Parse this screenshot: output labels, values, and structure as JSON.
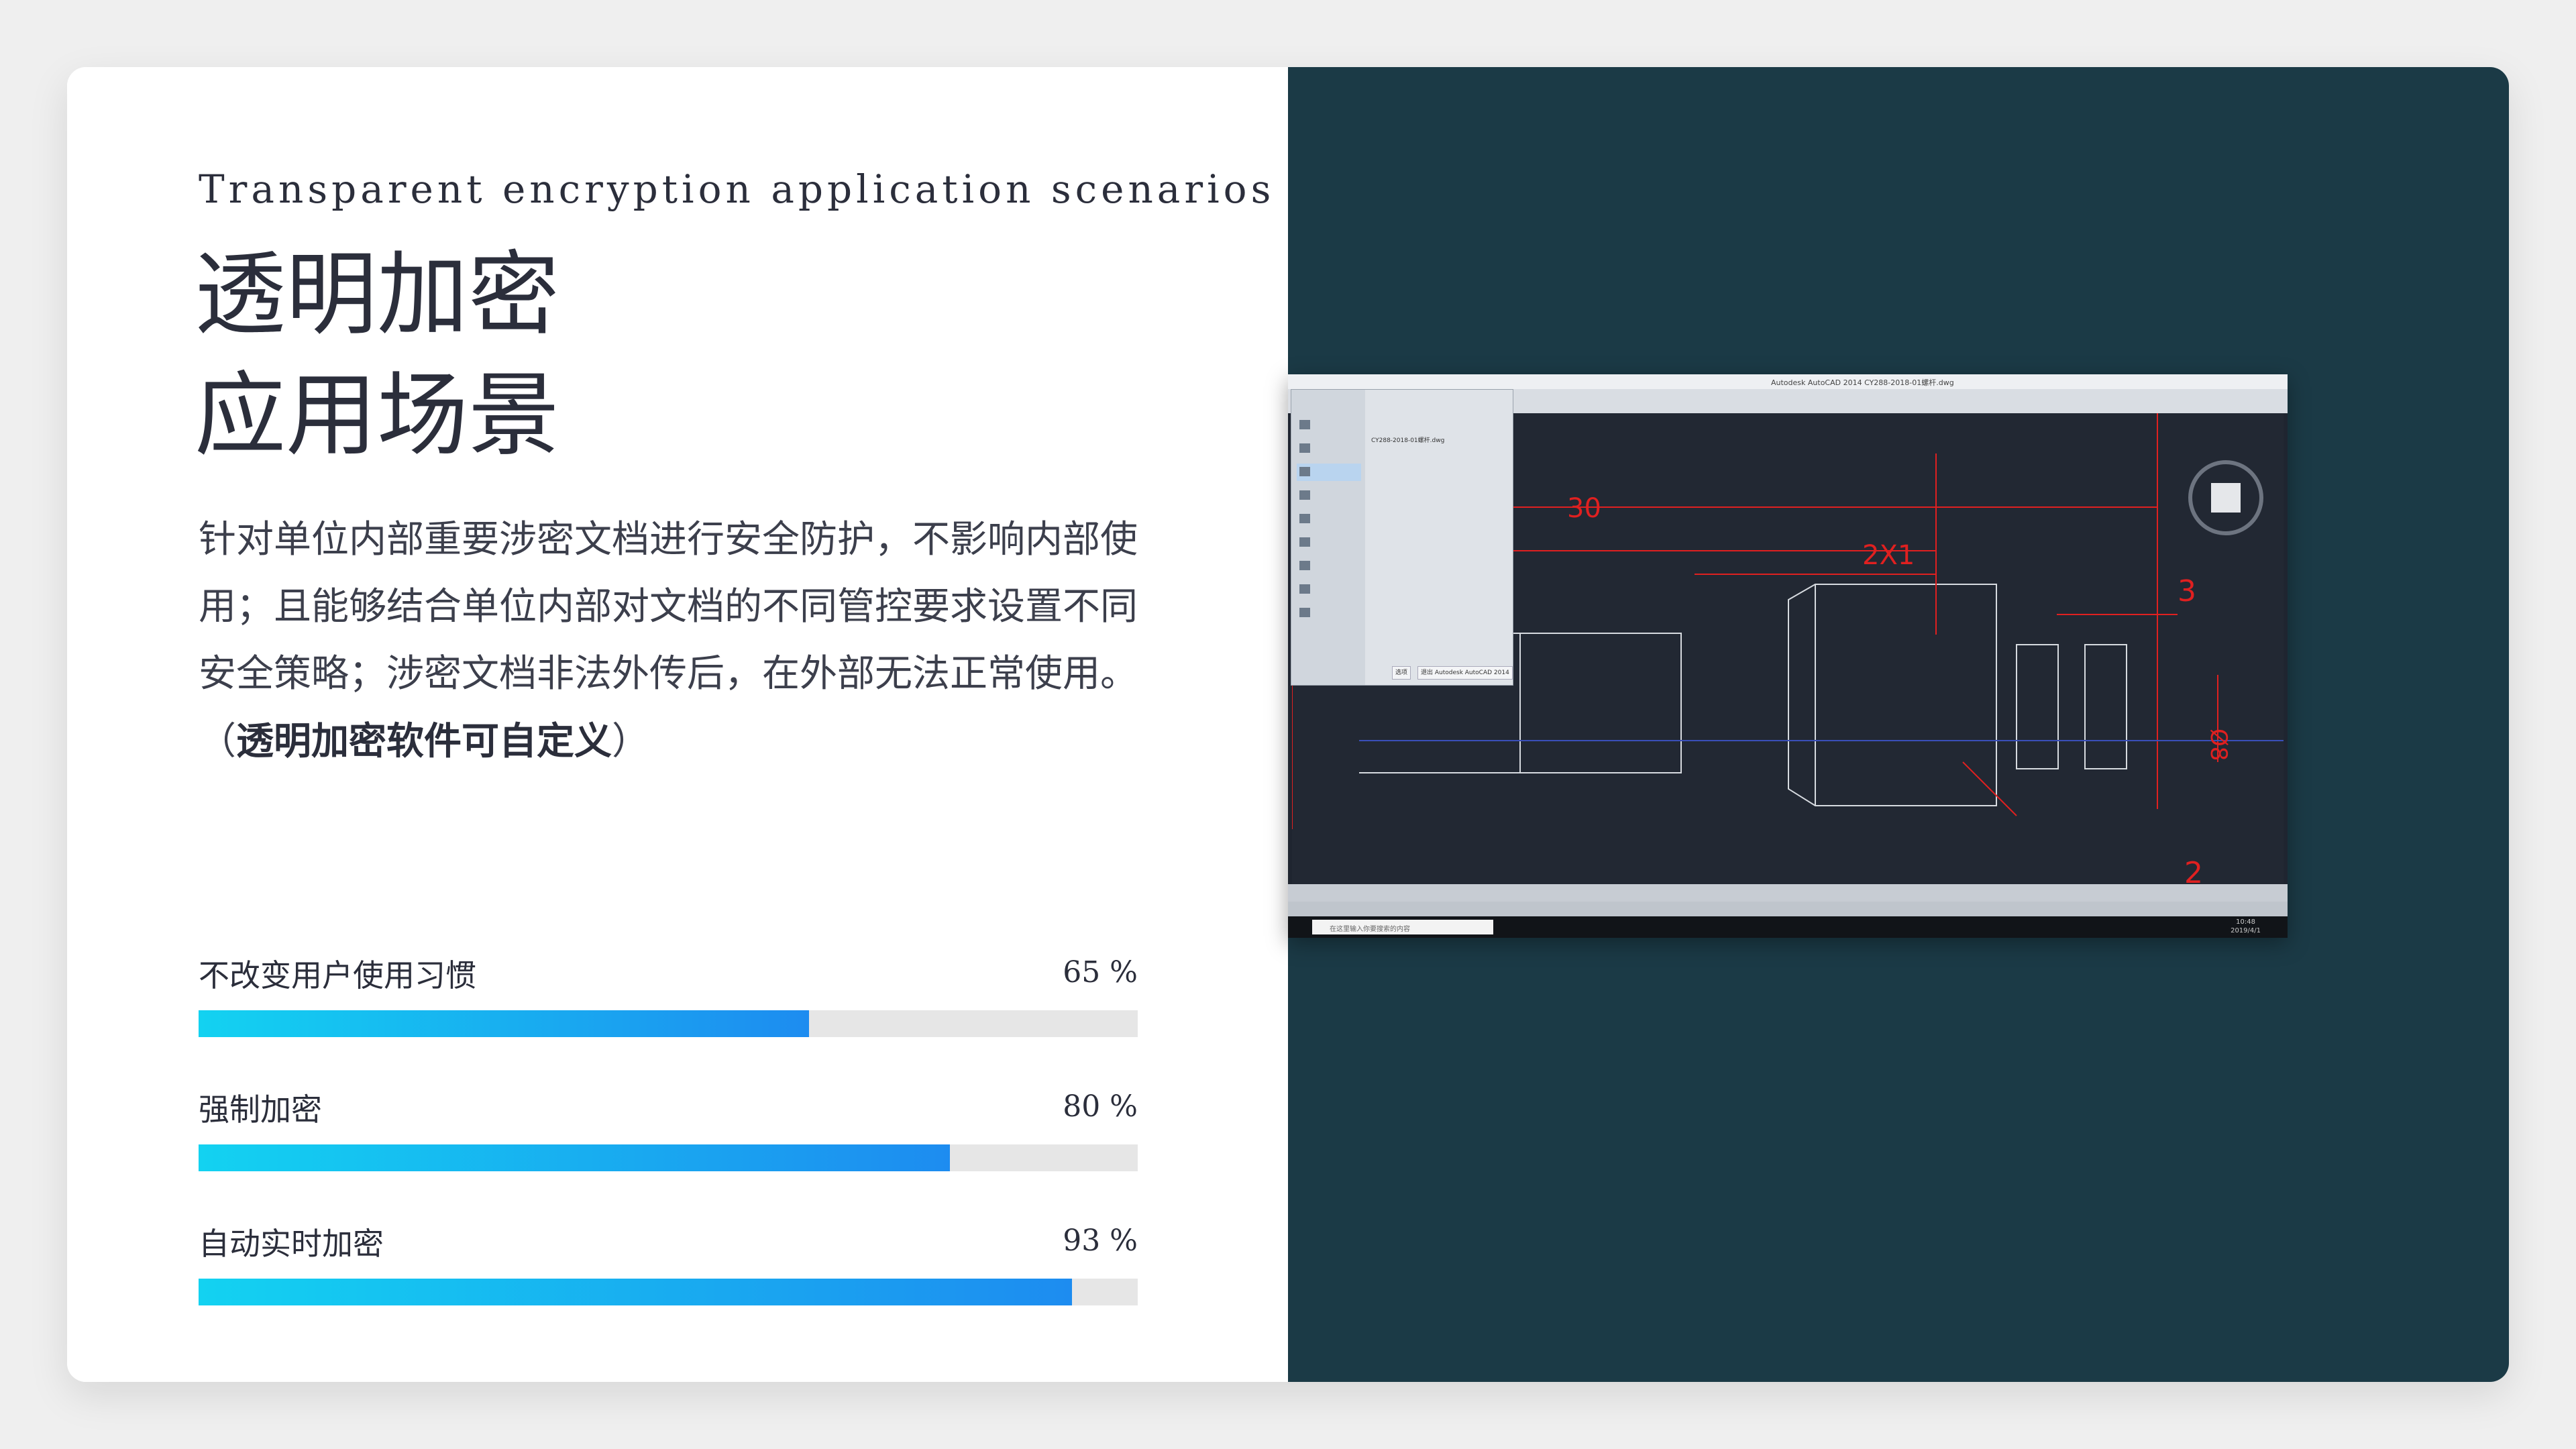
{
  "header": {
    "subtitle": "Transparent encryption application scenarios",
    "title_line1": "透明加密",
    "title_line2": "应用场景"
  },
  "description": {
    "text": "针对单位内部重要涉密文档进行安全防护，不影响内部使用；且能够结合单位内部对文档的不同管控要求设置不同安全策略；涉密文档非法外传后，在外部无法正常使用。（",
    "bold": "透明加密软件可自定义",
    "tail": "）"
  },
  "metrics": [
    {
      "label": "不改变用户使用习惯",
      "percent_label": "65 %",
      "value": 65
    },
    {
      "label": "强制加密",
      "percent_label": "80 %",
      "value": 80
    },
    {
      "label": "自动实时加密",
      "percent_label": "93 %",
      "value": 93
    }
  ],
  "screenshot": {
    "window_title": "Autodesk AutoCAD 2014    CY288-2018-01螺杆.dwg",
    "recent_file": "CY288-2018-01螺杆.dwg",
    "menu_button_options": "选项",
    "menu_button_exit": "退出 Autodesk AutoCAD 2014",
    "taskbar_search": "在这里输入你要搜索的内容",
    "clock_time": "10:48",
    "clock_date": "2019/4/1"
  },
  "colors": {
    "right_panel": "#1b3a46",
    "bar_gradient_start": "#13d2f1",
    "bar_gradient_end": "#1d8cf0",
    "bar_track": "#e6e6e6"
  }
}
